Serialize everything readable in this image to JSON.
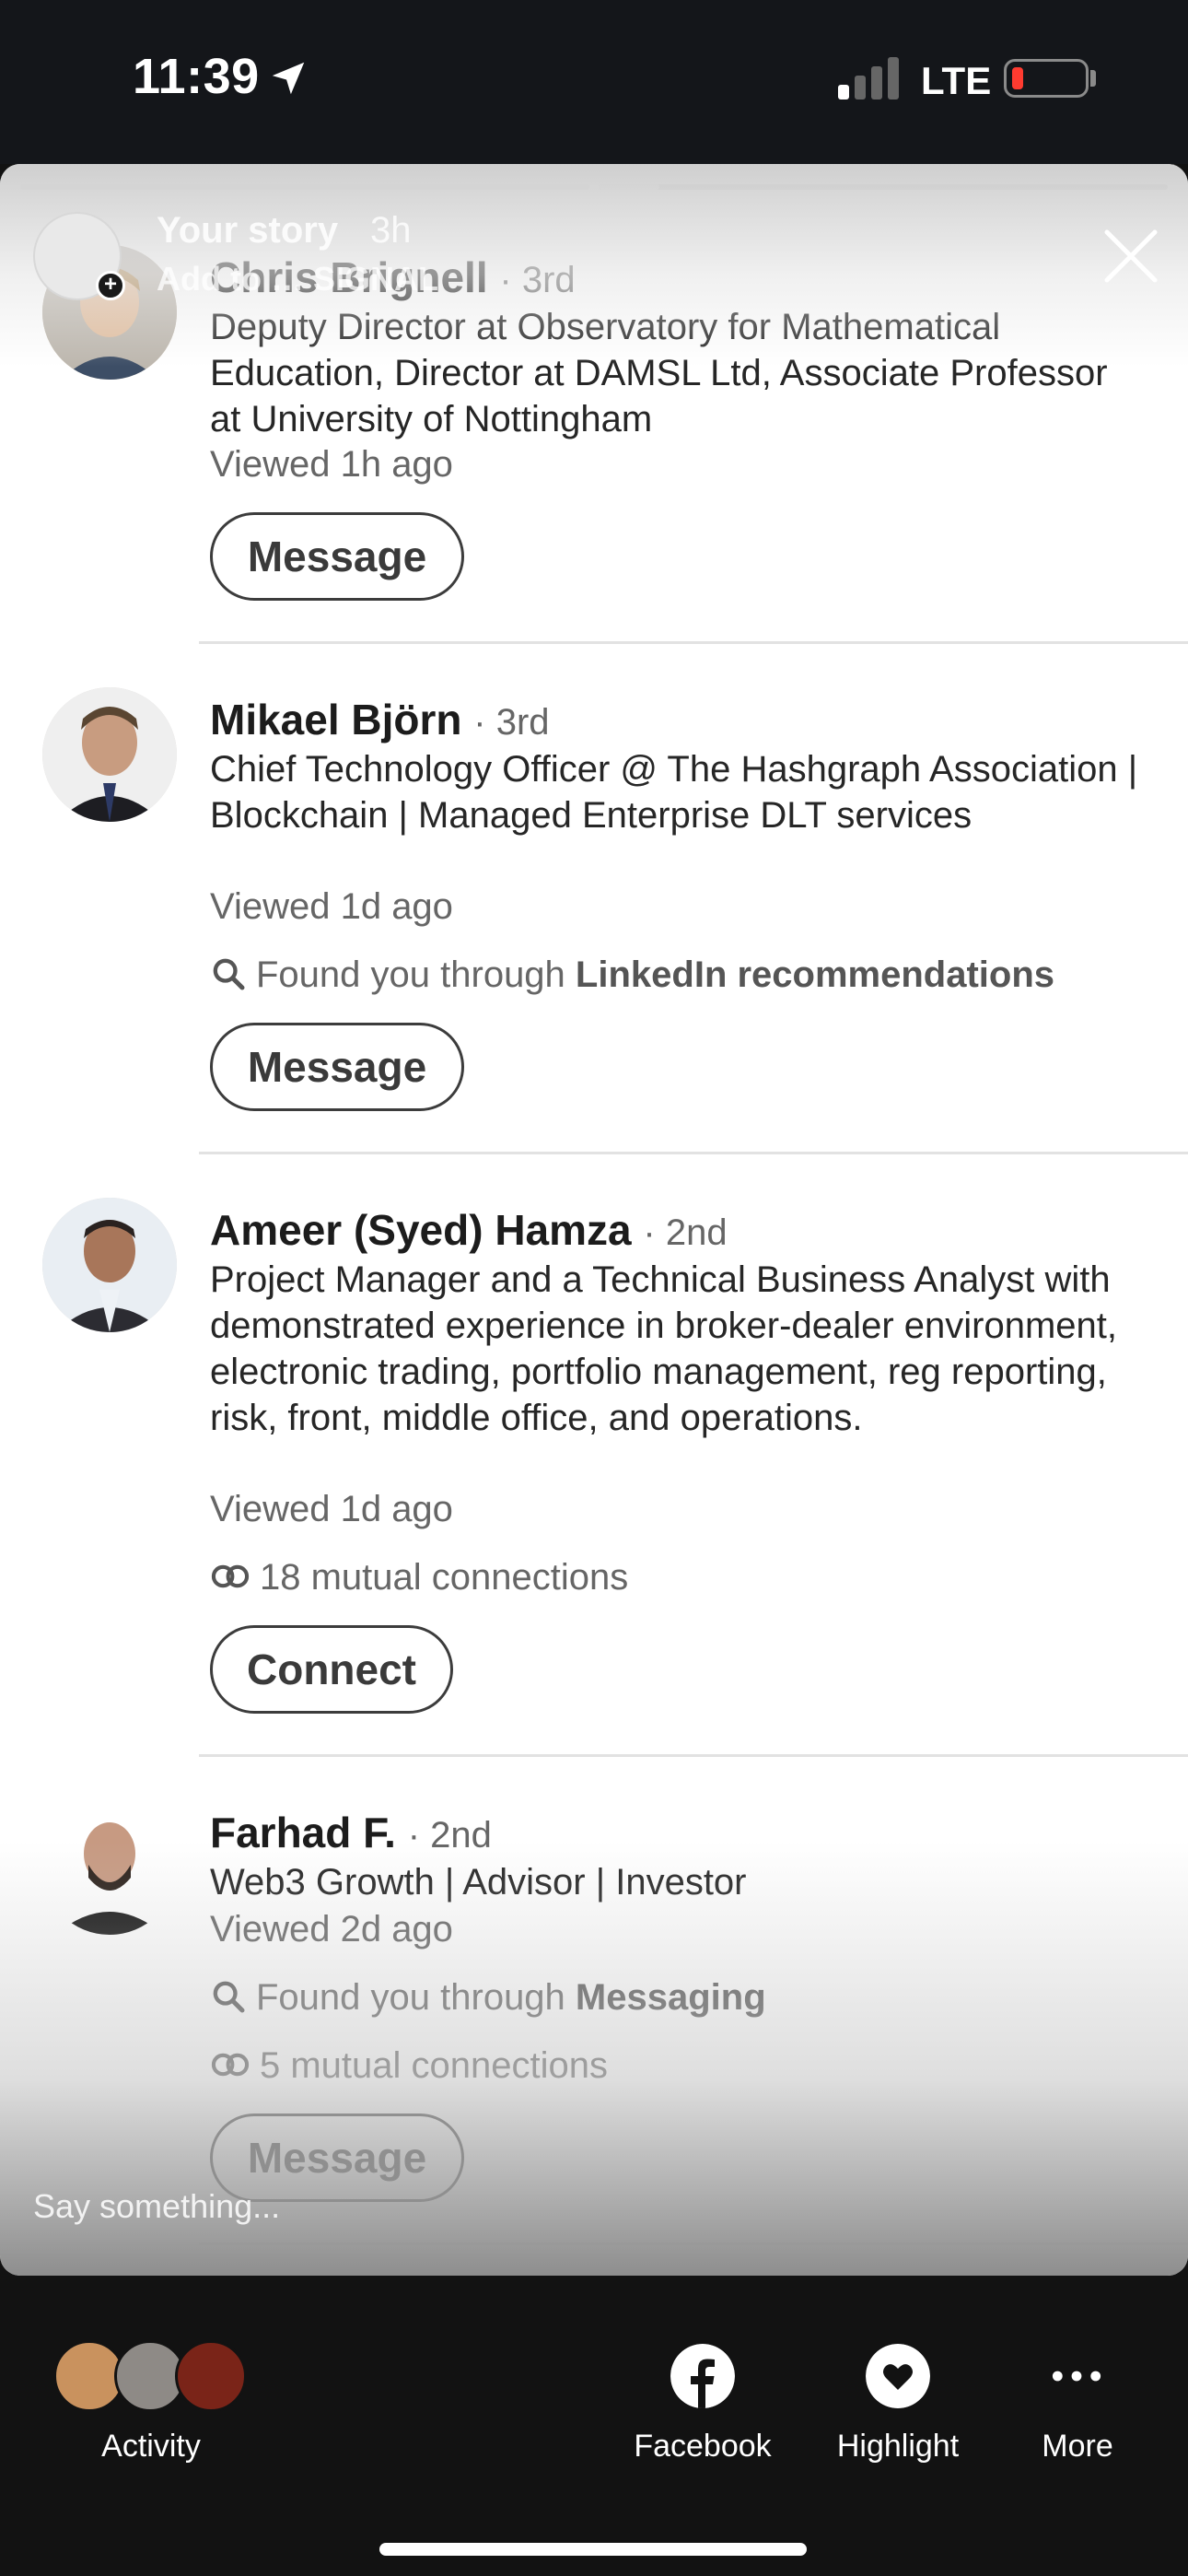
{
  "status_bar": {
    "time": "11:39",
    "network": "LTE"
  },
  "story": {
    "name": "Your story",
    "time": "3h",
    "subtitle": "Add to … SIGNAL",
    "composer_placeholder": "Say something..."
  },
  "viewers": [
    {
      "name": "Chris Brignell",
      "degree": "· 3rd",
      "headline": "Deputy Director at Observatory for Mathematical Education, Director at DAMSL Ltd, Associate Professor at University of Nottingham",
      "viewed": "Viewed 1h ago",
      "button": "Message"
    },
    {
      "name": "Mikael Björn",
      "degree": "· 3rd",
      "headline": "Chief Technology Officer @ The Hashgraph Association | Blockchain | Managed Enterprise DLT services",
      "viewed": "Viewed 1d ago",
      "found_prefix": "Found you through ",
      "found_source": "LinkedIn recommendations",
      "button": "Message"
    },
    {
      "name": "Ameer (Syed) Hamza",
      "degree": "· 2nd",
      "headline": "Project Manager and a Technical Business Analyst with demonstrated experience in broker-dealer environment, electronic trading, portfolio management, reg reporting, risk, front, middle office, and operations.",
      "viewed": "Viewed 1d ago",
      "mutual": "18 mutual connections",
      "button": "Connect"
    },
    {
      "name": "Farhad F.",
      "degree": "· 2nd",
      "headline": "Web3 Growth | Advisor | Investor",
      "viewed": "Viewed 2d ago",
      "found_prefix": "Found you through ",
      "found_source": "Messaging",
      "mutual": "5 mutual connections",
      "button": "Message"
    }
  ],
  "bottom_bar": {
    "activity": "Activity",
    "facebook": "Facebook",
    "highlight": "Highlight",
    "more": "More"
  },
  "icons": [
    "location-arrow-icon",
    "signal-icon",
    "battery-icon",
    "close-icon",
    "search-icon",
    "mutual-connections-icon",
    "facebook-icon",
    "heart-icon",
    "more-dots-icon"
  ],
  "colors": {
    "battery_low": "#ff3b30",
    "background": "#121212"
  }
}
